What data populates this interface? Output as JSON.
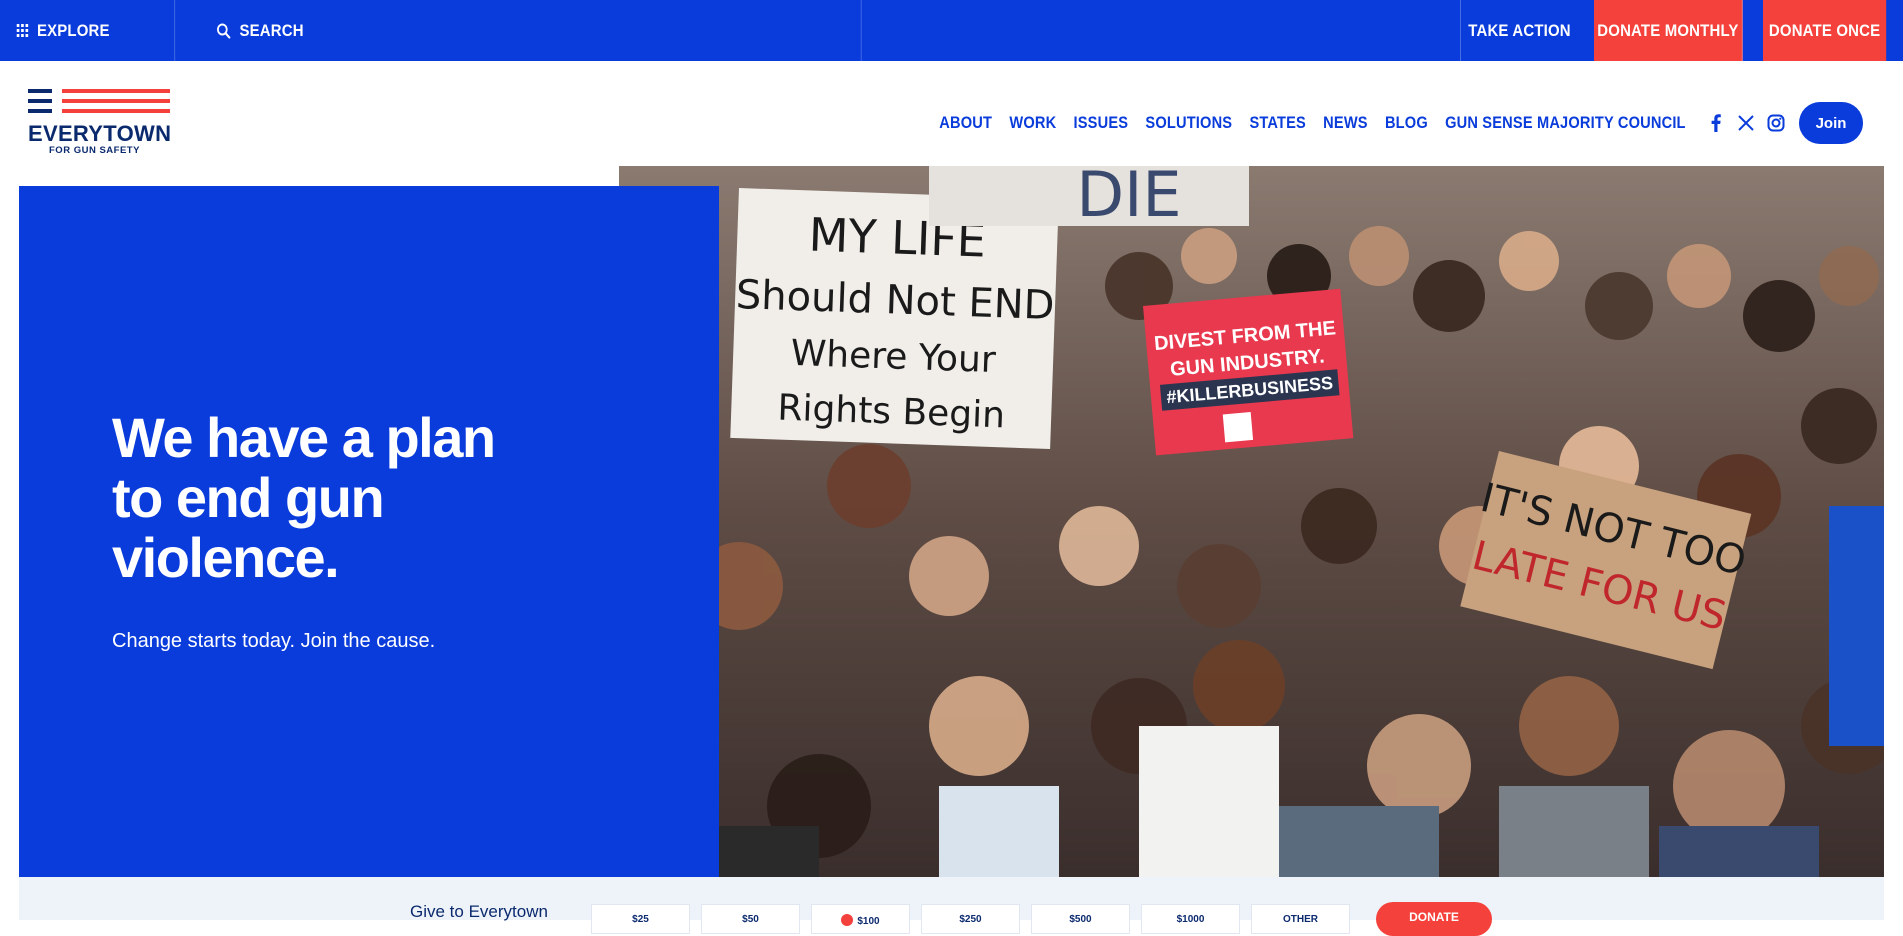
{
  "utility_bar": {
    "explore_label": "EXPLORE",
    "search_label": "SEARCH",
    "take_action_label": "TAKE ACTION",
    "donate_monthly_label": "DONATE MONTHLY",
    "donate_once_label": "DONATE ONCE"
  },
  "logo": {
    "wordmark": "EVERYTOWN",
    "tagline": "FOR GUN SAFETY"
  },
  "nav": {
    "items": [
      "ABOUT",
      "WORK",
      "ISSUES",
      "SOLUTIONS",
      "STATES",
      "NEWS",
      "BLOG",
      "GUN SENSE MAJORITY COUNCIL"
    ],
    "social": [
      "facebook-icon",
      "x-icon",
      "instagram-icon"
    ],
    "join_label": "Join"
  },
  "hero": {
    "title": "We have a plan to end gun violence.",
    "subtitle": "Change starts today. Join the cause.",
    "photo_signs": {
      "sign1_lines": [
        "MY LIFE",
        "Should Not END",
        "Where Your",
        "Rights Begin"
      ],
      "sign2_lines": [
        "DIVEST FROM THE",
        "GUN INDUSTRY.",
        "#KILLERBUSINESS"
      ],
      "sign3_lines": [
        "IT'S NOT TOO",
        "LATE FOR US"
      ],
      "sign4_text": "DIE"
    }
  },
  "donation": {
    "give_label": "Give to Everytown",
    "amounts": [
      "$25",
      "$50",
      "$100",
      "$250",
      "$500",
      "$1000",
      "OTHER"
    ],
    "selected_index": 2,
    "donate_label": "DONATE"
  },
  "colors": {
    "brand_blue": "#0a3cdb",
    "accent_red": "#f5413b",
    "navy": "#0b2a6e",
    "bar_bg": "#eef3fa"
  }
}
